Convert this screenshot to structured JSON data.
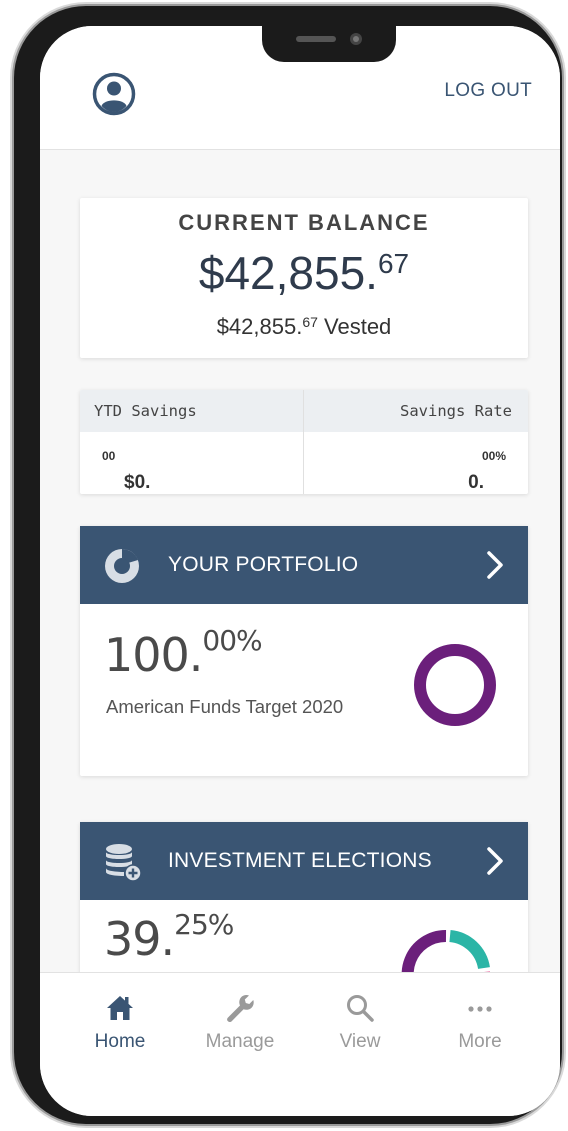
{
  "header": {
    "logout_label": "LOG OUT"
  },
  "balance": {
    "label": "CURRENT BALANCE",
    "amount_main": "$42,855.",
    "amount_cents": "67",
    "vested_main": "$42,855.",
    "vested_cents": "67",
    "vested_suffix": " Vested"
  },
  "savings": {
    "ytd_label": "YTD Savings",
    "rate_label": "Savings Rate",
    "ytd_main": "$0.",
    "ytd_cents": "00",
    "rate_main": "0.",
    "rate_cents": "00%"
  },
  "portfolio": {
    "title": "YOUR PORTFOLIO",
    "pct_main": "100.",
    "pct_frac": "00%",
    "fund_name": "American Funds Target 2020",
    "donut_color": "#6b1f7b"
  },
  "investment": {
    "title": "INVESTMENT ELECTIONS",
    "pct_main": "39.",
    "pct_frac": "25%",
    "donut_colors": [
      "#6b1f7b",
      "#2bb5a6",
      "#e0287a"
    ]
  },
  "nav": {
    "items": [
      {
        "label": "Home",
        "icon": "home-icon",
        "active": true
      },
      {
        "label": "Manage",
        "icon": "wrench-icon",
        "active": false
      },
      {
        "label": "View",
        "icon": "search-icon",
        "active": false
      },
      {
        "label": "More",
        "icon": "more-icon",
        "active": false
      }
    ]
  },
  "colors": {
    "primary": "#3a5573",
    "accent_purple": "#6b1f7b",
    "accent_teal": "#2bb5a6",
    "accent_pink": "#e0287a"
  }
}
